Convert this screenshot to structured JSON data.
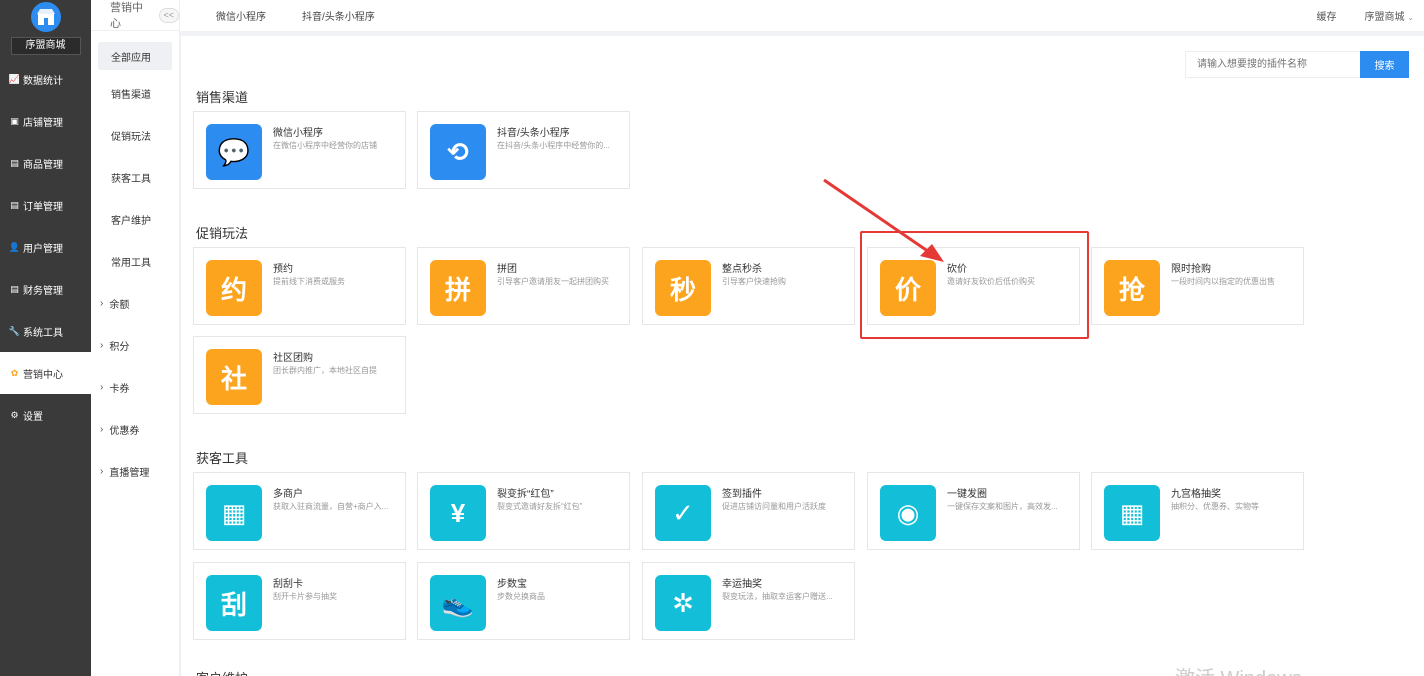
{
  "sidebar": {
    "shop_name": "序盟商城",
    "items": [
      {
        "label": "数据统计",
        "icon": "chart-icon"
      },
      {
        "label": "店铺管理",
        "icon": "store-icon"
      },
      {
        "label": "商品管理",
        "icon": "product-icon"
      },
      {
        "label": "订单管理",
        "icon": "order-icon"
      },
      {
        "label": "用户管理",
        "icon": "user-icon"
      },
      {
        "label": "财务管理",
        "icon": "finance-icon"
      },
      {
        "label": "系统工具",
        "icon": "wrench-icon"
      },
      {
        "label": "营销中心",
        "icon": "marketing-icon"
      },
      {
        "label": "设置",
        "icon": "gear-icon"
      }
    ]
  },
  "subnav": {
    "title": "营销中心",
    "collapse": "<<",
    "items": [
      {
        "label": "全部应用"
      },
      {
        "label": "销售渠道"
      },
      {
        "label": "促销玩法"
      },
      {
        "label": "获客工具"
      },
      {
        "label": "客户维护"
      },
      {
        "label": "常用工具"
      },
      {
        "label": "余额"
      },
      {
        "label": "积分"
      },
      {
        "label": "卡券"
      },
      {
        "label": "优惠券"
      },
      {
        "label": "直播管理"
      }
    ]
  },
  "topbar": {
    "tabs": [
      "微信小程序",
      "抖音/头条小程序"
    ],
    "cache": "缓存",
    "shop_menu": "序盟商城"
  },
  "search": {
    "placeholder": "请输入想要搜的插件名称",
    "button": "搜索"
  },
  "sections": {
    "sales": {
      "title": "销售渠道",
      "cards": [
        {
          "title": "微信小程序",
          "desc": "在微信小程序中经营你的店铺",
          "glyph": "💬",
          "icon": "wechat-icon"
        },
        {
          "title": "抖音/头条小程序",
          "desc": "在抖音/头条小程序中经营你的...",
          "glyph": "⟲",
          "icon": "douyin-icon"
        }
      ]
    },
    "promo": {
      "title": "促销玩法",
      "cards": [
        {
          "title": "预约",
          "desc": "提前线下消费或服务",
          "glyph": "约",
          "icon": "reservation-icon"
        },
        {
          "title": "拼团",
          "desc": "引导客户邀请朋友一起拼团购买",
          "glyph": "拼",
          "icon": "group-buy-icon"
        },
        {
          "title": "整点秒杀",
          "desc": "引导客户快速抢购",
          "glyph": "秒",
          "icon": "flash-sale-icon"
        },
        {
          "title": "砍价",
          "desc": "邀请好友砍价后低价购买",
          "glyph": "价",
          "icon": "bargain-icon"
        },
        {
          "title": "限时抢购",
          "desc": "一段时间内以指定的优惠出售",
          "glyph": "抢",
          "icon": "limited-time-icon"
        },
        {
          "title": "社区团购",
          "desc": "团长群内推广，本地社区自提",
          "glyph": "社",
          "icon": "community-icon"
        }
      ]
    },
    "acquire": {
      "title": "获客工具",
      "cards": [
        {
          "title": "多商户",
          "desc": "获取入驻商流量，自营+商户入...",
          "glyph": "▦",
          "icon": "merchant-icon"
        },
        {
          "title": "裂变拆“红包”",
          "desc": "裂变式邀请好友拆“红包”",
          "glyph": "¥",
          "icon": "red-packet-icon"
        },
        {
          "title": "签到插件",
          "desc": "促进店铺访问量和用户活跃度",
          "glyph": "✓",
          "icon": "checkin-icon"
        },
        {
          "title": "一键发圈",
          "desc": "一键保存文案和图片，高效发...",
          "glyph": "◉",
          "icon": "moments-icon"
        },
        {
          "title": "九宫格抽奖",
          "desc": "抽积分、优惠券、实物等",
          "glyph": "▦",
          "icon": "grid-lottery-icon"
        },
        {
          "title": "刮刮卡",
          "desc": "刮开卡片参与抽奖",
          "glyph": "刮",
          "icon": "scratch-card-icon"
        },
        {
          "title": "步数宝",
          "desc": "步数兑换商品",
          "glyph": "👟",
          "icon": "steps-icon"
        },
        {
          "title": "幸运抽奖",
          "desc": "裂变玩法，抽取幸运客户赠送...",
          "glyph": "✲",
          "icon": "lucky-wheel-icon"
        }
      ]
    }
  },
  "bottom_partial_title": "客户维护",
  "watermark": "激活 Windows",
  "colors": {
    "accent": "#2d8cf0",
    "orange": "#fda41f",
    "cyan": "#13bfd8",
    "highlight": "#e53935",
    "sidebar": "#3a3a3a"
  }
}
